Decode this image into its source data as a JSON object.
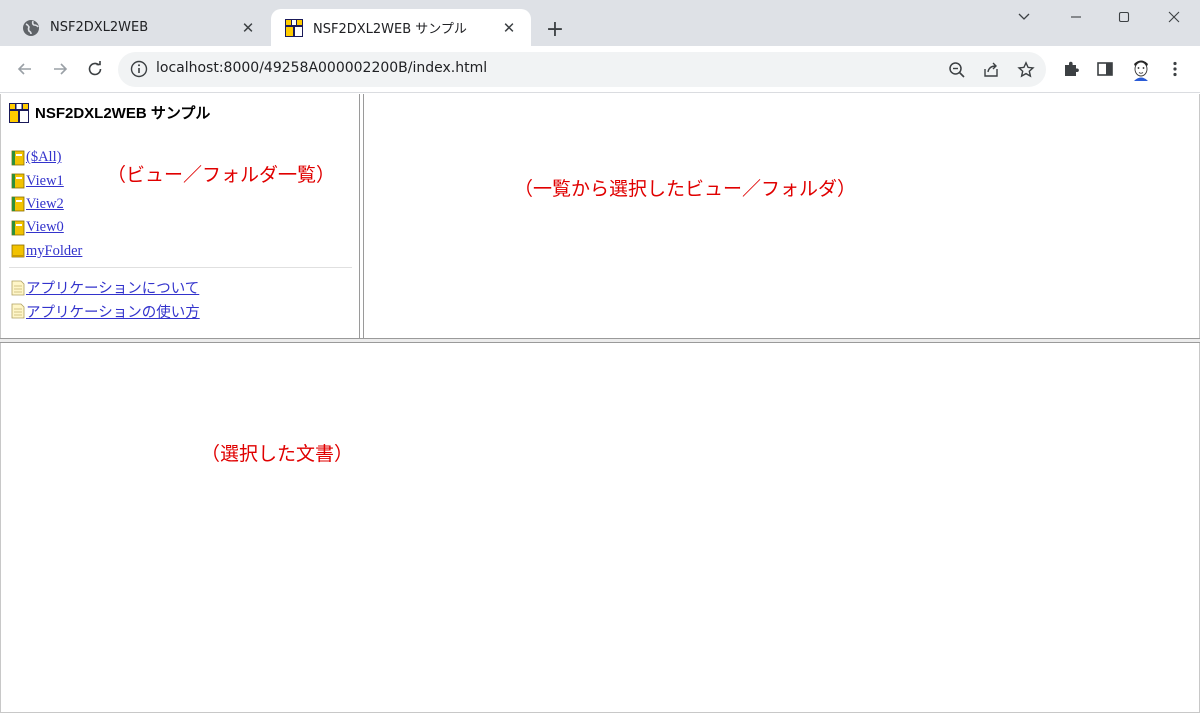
{
  "tabs": [
    {
      "title": "NSF2DXL2WEB",
      "active": false,
      "icon": "globe-icon"
    },
    {
      "title": "NSF2DXL2WEB サンプル",
      "active": true,
      "icon": "nsf-logo-icon"
    }
  ],
  "toolbar": {
    "url": "localhost:8000/49258A000002200B/index.html"
  },
  "nav": {
    "heading": "NSF2DXL2WEB サンプル",
    "views": [
      {
        "label": "($All)",
        "icon": "view-icon"
      },
      {
        "label": "View1",
        "icon": "view-icon"
      },
      {
        "label": "View2",
        "icon": "view-icon"
      },
      {
        "label": "View0",
        "icon": "view-icon"
      },
      {
        "label": "myFolder",
        "icon": "folder-icon"
      }
    ],
    "documents": [
      {
        "label": "アプリケーションについて",
        "icon": "document-icon"
      },
      {
        "label": "アプリケーションの使い方",
        "icon": "document-icon"
      }
    ]
  },
  "annotations": {
    "left": "（ビュー／フォルダ一覧）",
    "right": "（一覧から選択したビュー／フォルダ）",
    "bottom": "（選択した文書）"
  },
  "colors": {
    "link": "#3333cc",
    "annotation": "#e00000",
    "tabstrip": "#dee1e6"
  }
}
